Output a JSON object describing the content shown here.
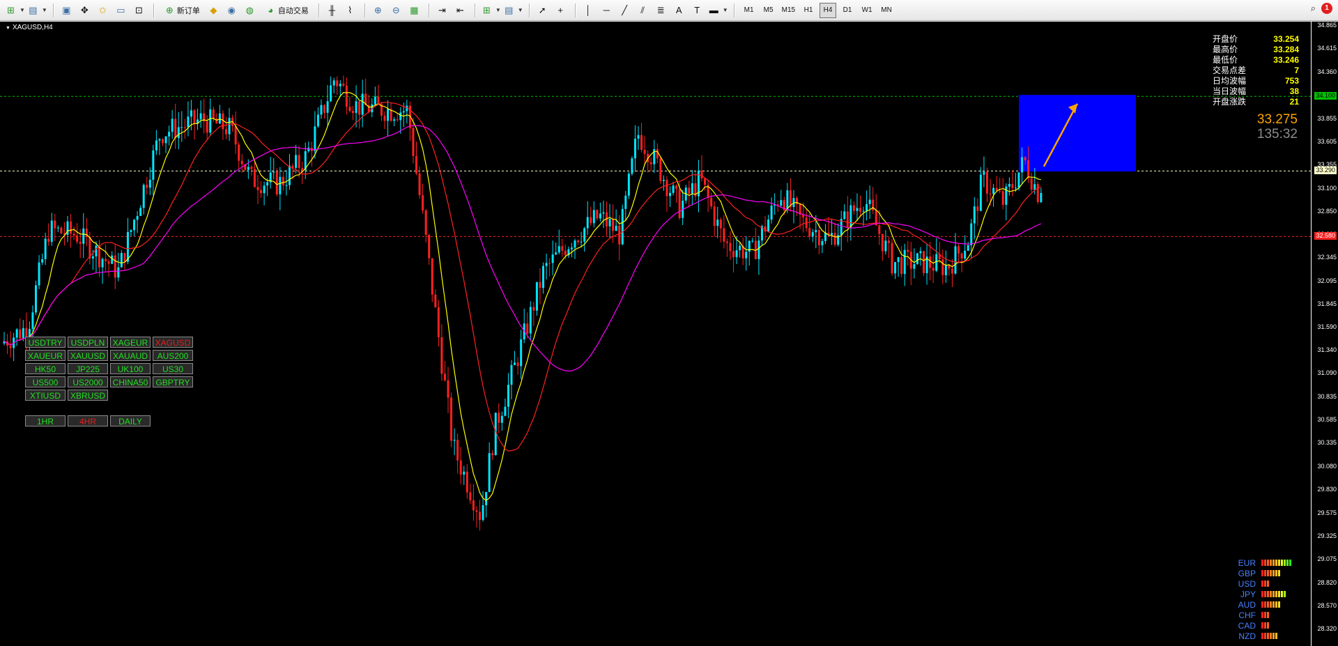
{
  "toolbar": {
    "new_order_label": "新订单",
    "auto_trading_label": "自动交易",
    "timeframes": [
      "M1",
      "M5",
      "M15",
      "H1",
      "H4",
      "D1",
      "W1",
      "MN"
    ],
    "active_timeframe": "H4",
    "notification_count": "1"
  },
  "chart": {
    "symbol_label": "XAGUSD,H4",
    "colors": {
      "background": "#000000",
      "bull_candle": "#00e5ff",
      "bear_candle": "#ff2020",
      "ma_fast": "#ffff00",
      "ma_mid": "#ff2020",
      "ma_slow": "#ff00ff",
      "target_box": "#0000ff",
      "arrow": "#ffa500",
      "level_top": "#00c000",
      "level_current": "#ffffcc",
      "level_bottom": "#ff2020"
    },
    "price_ticks": [
      "34.865",
      "34.615",
      "34.360",
      "34.100",
      "33.855",
      "33.605",
      "33.355",
      "33.100",
      "32.850",
      "32.600",
      "32.345",
      "32.095",
      "31.845",
      "31.590",
      "31.340",
      "31.090",
      "30.835",
      "30.585",
      "30.335",
      "30.080",
      "29.830",
      "29.575",
      "29.325",
      "29.075",
      "28.820",
      "28.570",
      "28.320"
    ],
    "level_tags": {
      "top": "34.100",
      "current": "33.290",
      "bottom": "32.580"
    }
  },
  "info_panel": {
    "rows": [
      {
        "label": "开盘价",
        "value": "33.254"
      },
      {
        "label": "最高价",
        "value": "33.284"
      },
      {
        "label": "最低价",
        "value": "33.246"
      },
      {
        "label": "交易点差",
        "value": "7"
      },
      {
        "label": "日均波幅",
        "value": "753"
      },
      {
        "label": "当日波幅",
        "value": "38"
      },
      {
        "label": "开盘涨跌",
        "value": "21"
      }
    ],
    "current_price": "33.275",
    "countdown": "135:32"
  },
  "symbol_buttons": [
    {
      "label": "USDTRY",
      "active": false
    },
    {
      "label": "USDPLN",
      "active": false
    },
    {
      "label": "XAGEUR",
      "active": false
    },
    {
      "label": "XAGUSD",
      "active": true
    },
    {
      "label": "XAUEUR",
      "active": false
    },
    {
      "label": "XAUUSD",
      "active": false
    },
    {
      "label": "XAUAUD",
      "active": false
    },
    {
      "label": "AUS200",
      "active": false
    },
    {
      "label": "HK50",
      "active": false
    },
    {
      "label": "JP225",
      "active": false
    },
    {
      "label": "UK100",
      "active": false
    },
    {
      "label": "US30",
      "active": false
    },
    {
      "label": "US500",
      "active": false
    },
    {
      "label": "US2000",
      "active": false
    },
    {
      "label": "CHINA50",
      "active": false
    },
    {
      "label": "GBPTRY",
      "active": false
    },
    {
      "label": "XTIUSD",
      "active": false
    },
    {
      "label": "XBRUSD",
      "active": false
    }
  ],
  "timeframe_buttons": [
    {
      "label": "1HR",
      "active": false
    },
    {
      "label": "4HR",
      "active": true
    },
    {
      "label": "DAILY",
      "active": false
    }
  ],
  "currency_strength": [
    {
      "name": "EUR",
      "level": 11
    },
    {
      "name": "GBP",
      "level": 7
    },
    {
      "name": "USD",
      "level": 3
    },
    {
      "name": "JPY",
      "level": 9
    },
    {
      "name": "AUD",
      "level": 7
    },
    {
      "name": "CHF",
      "level": 3
    },
    {
      "name": "CAD",
      "level": 3
    },
    {
      "name": "NZD",
      "level": 6
    }
  ]
}
